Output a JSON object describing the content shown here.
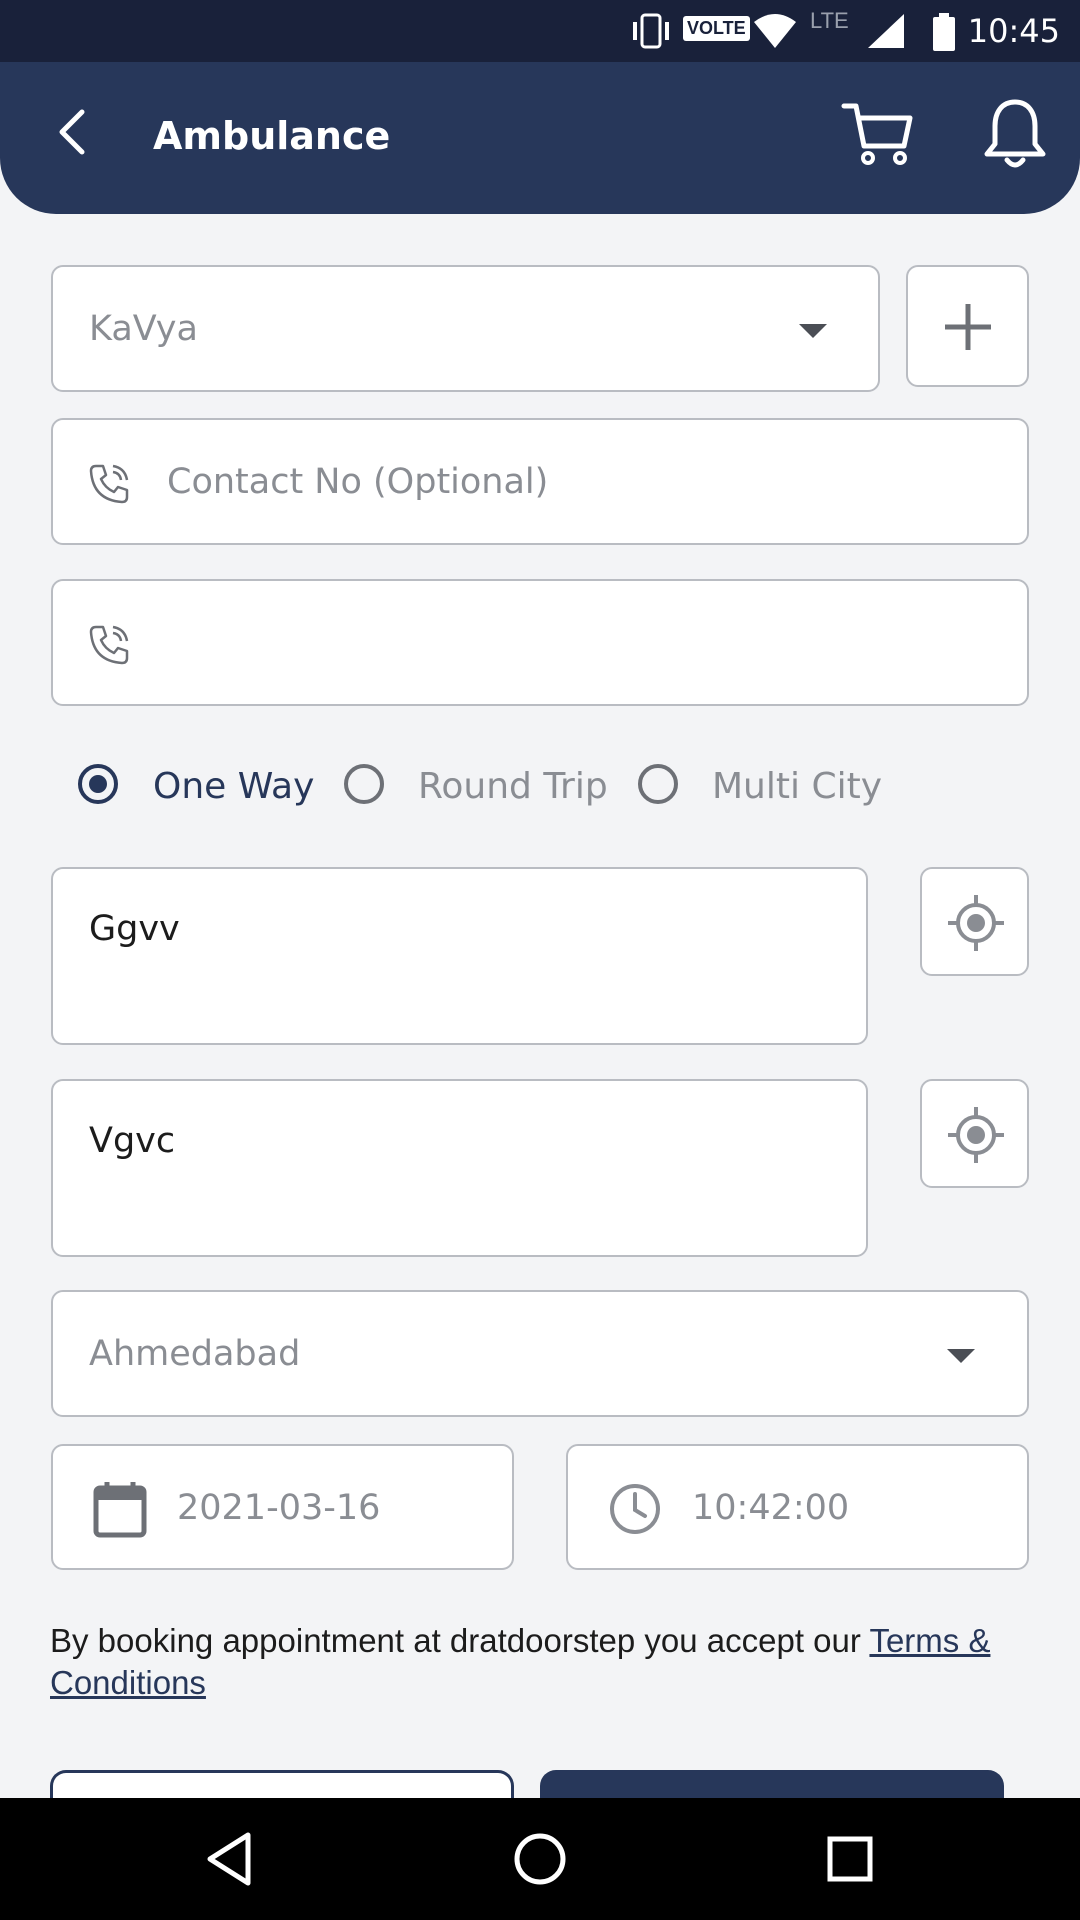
{
  "status_bar": {
    "time": "10:45",
    "volte": "VOLTE",
    "network": "LTE"
  },
  "header": {
    "title": "Ambulance"
  },
  "form": {
    "patient_select": {
      "value": "KaVya"
    },
    "contact_field": {
      "placeholder": "Contact No (Optional)",
      "value": ""
    },
    "phone_field": {
      "value": ""
    },
    "trip_types": [
      {
        "label": "One Way",
        "selected": true
      },
      {
        "label": "Round Trip",
        "selected": false
      },
      {
        "label": "Multi City",
        "selected": false
      }
    ],
    "pickup_address": "Ggvv",
    "drop_address": "Vgvc",
    "city_select": {
      "value": "Ahmedabad"
    },
    "date": "2021-03-16",
    "time": "10:42:00"
  },
  "terms": {
    "text": "By booking appointment at dratdoorstep you accept our ",
    "link": "Terms & Conditions"
  },
  "colors": {
    "primary": "#27375a",
    "status_bar": "#19213a",
    "background": "#f3f4f6"
  }
}
